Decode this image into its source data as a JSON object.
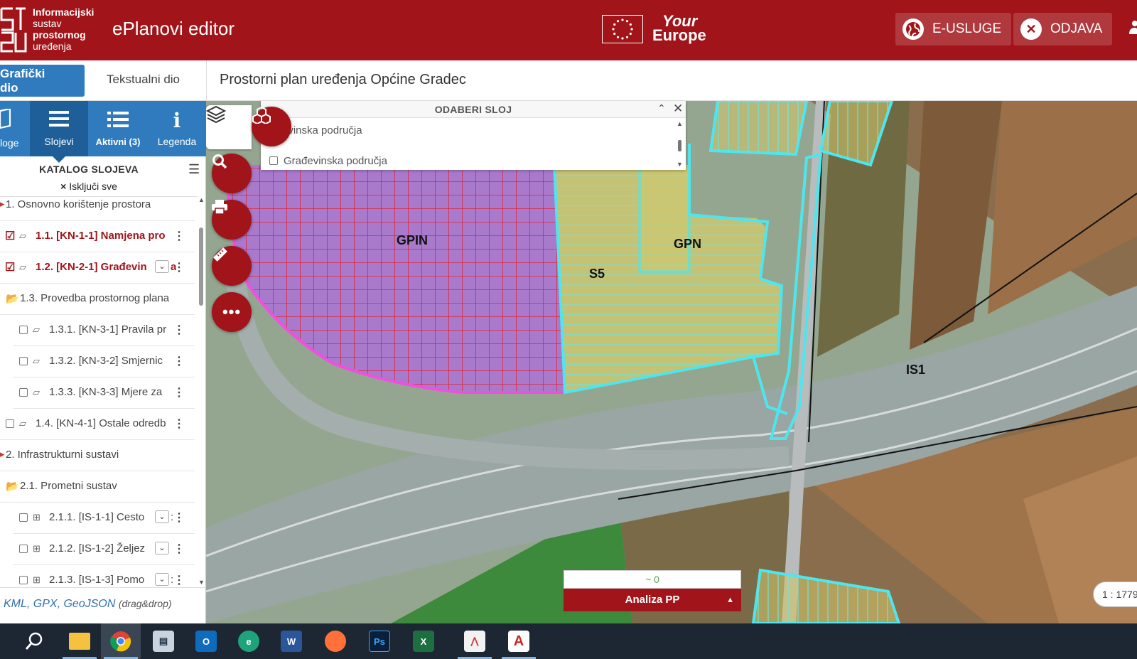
{
  "header": {
    "logo_lines": [
      "Informacijski",
      "sustav",
      "prostornog",
      "uređenja"
    ],
    "app_title": "ePlanovi editor",
    "your_europe_line1": "Your",
    "your_europe_line2": "Europe",
    "e_usluge_label": "E-USLUGE",
    "odjava_label": "ODJAVA"
  },
  "subbar": {
    "graficki_tab": "Grafički dio",
    "tekstualni_tab": "Tekstualni dio",
    "plan_title": "Prostorni plan uređenja Općine Gradec"
  },
  "sidebar": {
    "tabs": [
      {
        "label": "loge",
        "icon": "map-icon"
      },
      {
        "label": "Slojevi",
        "icon": "menu-icon"
      },
      {
        "label": "Aktivni (3)",
        "icon": "list-icon"
      },
      {
        "label": "Legenda",
        "icon": "info-icon"
      }
    ],
    "catalog_title": "KATALOG SLOJEVA",
    "iskljuci": "Isključi sve",
    "tree": [
      {
        "text": "1. Osnovno korištenje prostora",
        "type": "group"
      },
      {
        "text": "1.1. [KN-1-1] Namjena pro",
        "type": "checked"
      },
      {
        "text": "1.2. [KN-2-1] Građevin",
        "type": "checked-select",
        "overflow": "a"
      },
      {
        "text": "1.3. Provedba prostornog plana",
        "type": "folder"
      },
      {
        "text": "1.3.1. [KN-3-1] Pravila pr",
        "type": "layer"
      },
      {
        "text": "1.3.2. [KN-3-2] Smjernic",
        "type": "layer"
      },
      {
        "text": "1.3.3. [KN-3-3] Mjere za",
        "type": "layer"
      },
      {
        "text": "1.4. [KN-4-1] Ostale odredb",
        "type": "layer-top"
      },
      {
        "text": "2. Infrastrukturni sustavi",
        "type": "group"
      },
      {
        "text": "2.1. Prometni sustav",
        "type": "folder"
      },
      {
        "text": "2.1.1. [IS-1-1] Cesto",
        "type": "grid-select",
        "overflow": ":"
      },
      {
        "text": "2.1.2. [IS-1-2] Željez",
        "type": "grid-select",
        "overflow": ""
      },
      {
        "text": "2.1.3. [IS-1-3] Pomo",
        "type": "grid-select",
        "overflow": ":"
      }
    ],
    "kml_main": "KML, GPX, GeoJSON",
    "kml_note": "(drag&drop)"
  },
  "layer_panel": {
    "title": "ODABERI SLOJ",
    "item_partial": "evinska područja",
    "item_full": "Građevinska područja"
  },
  "map": {
    "labels": [
      "GPIN",
      "GPN",
      "S5",
      "IS1"
    ],
    "tools": [
      "layers-icon",
      "cubes-icon",
      "search-icon",
      "print-icon",
      "ruler-icon",
      "more-icon"
    ]
  },
  "analiza": {
    "value": "~ 0",
    "label": "Analiza PP"
  },
  "scale": "1 : 1779",
  "taskbar": [
    "search-icon",
    "file-explorer-icon",
    "chrome-icon",
    "app-icon",
    "outlook-icon",
    "edge-icon",
    "word-icon",
    "firefox-icon",
    "photoshop-icon",
    "excel-icon",
    "pdf-icon",
    "acrobat-icon"
  ],
  "colors": {
    "brand_red": "#a11419",
    "tab_blue": "#2f7bbd",
    "gpin_fill": "#b26bd9",
    "cyan_border": "#4ee6ee",
    "magenta_border": "#f04fe0"
  }
}
